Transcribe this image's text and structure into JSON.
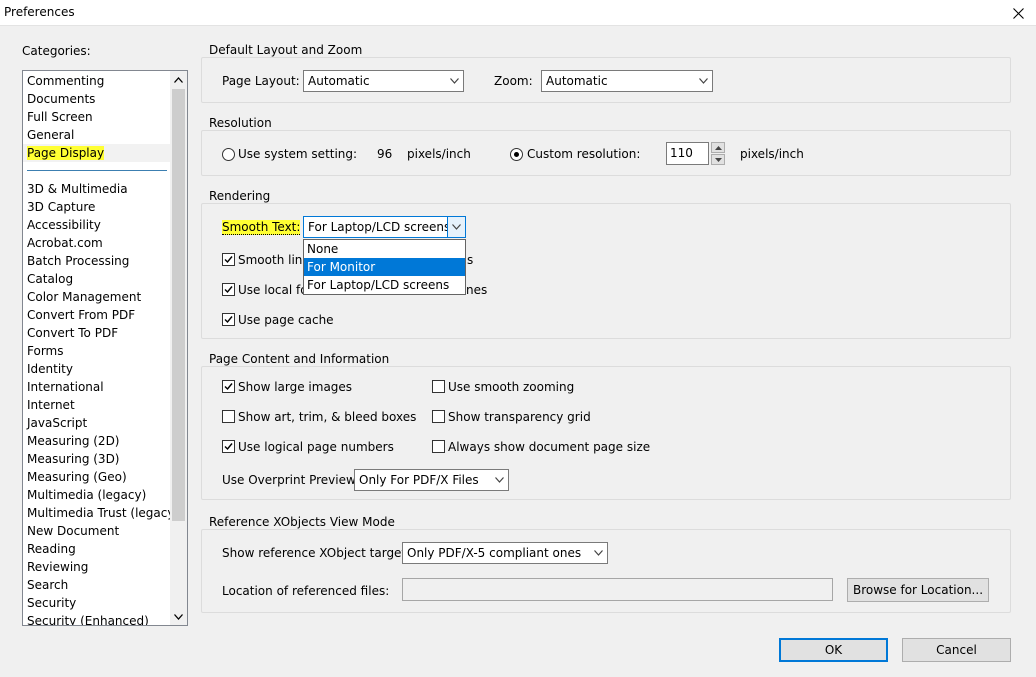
{
  "window": {
    "title": "Preferences"
  },
  "categories": {
    "label": "Categories:",
    "top_items": [
      "Commenting",
      "Documents",
      "Full Screen",
      "General",
      "Page Display"
    ],
    "items": [
      "3D & Multimedia",
      "3D Capture",
      "Accessibility",
      "Acrobat.com",
      "Batch Processing",
      "Catalog",
      "Color Management",
      "Convert From PDF",
      "Convert To PDF",
      "Forms",
      "Identity",
      "International",
      "Internet",
      "JavaScript",
      "Measuring (2D)",
      "Measuring (3D)",
      "Measuring (Geo)",
      "Multimedia (legacy)",
      "Multimedia Trust (legacy)",
      "New Document",
      "Reading",
      "Reviewing",
      "Search",
      "Security",
      "Security (Enhanced)"
    ],
    "selected": "Page Display"
  },
  "layout_zoom": {
    "title": "Default Layout and Zoom",
    "page_layout_label": "Page Layout:",
    "page_layout_value": "Automatic",
    "zoom_label": "Zoom:",
    "zoom_value": "Automatic"
  },
  "resolution": {
    "title": "Resolution",
    "system_label": "Use system setting:",
    "system_value": "96",
    "system_unit": "pixels/inch",
    "custom_label": "Custom resolution:",
    "custom_value": "110",
    "custom_unit": "pixels/inch"
  },
  "rendering": {
    "title": "Rendering",
    "smooth_text_label": "Smooth Text:",
    "smooth_text_value": "For Laptop/LCD screens",
    "smooth_line_label_visible": "Smooth line",
    "smooth_line_tail": "s",
    "local_fonts_label_visible": "Use local fo",
    "local_fonts_tail": "nes",
    "page_cache_label": "Use page cache",
    "dropdown_options": [
      "None",
      "For Monitor",
      "For Laptop/LCD screens"
    ],
    "dropdown_highlighted": "For Monitor"
  },
  "page_content": {
    "title": "Page Content and Information",
    "show_large_images": "Show large images",
    "smooth_zooming": "Use smooth zooming",
    "show_art_boxes": "Show art, trim, & bleed boxes",
    "transparency_grid": "Show transparency grid",
    "logical_page_numbers": "Use logical page numbers",
    "document_page_size": "Always show document page size",
    "overprint_label": "Use Overprint Preview:",
    "overprint_value": "Only For PDF/X Files"
  },
  "xobjects": {
    "title": "Reference XObjects View Mode",
    "targets_label": "Show reference XObject targets:",
    "targets_value": "Only PDF/X-5 compliant ones",
    "location_label": "Location of referenced files:",
    "location_value": "",
    "browse_label": "Browse for Location..."
  },
  "footer": {
    "ok_label": "OK",
    "cancel_label": "Cancel"
  },
  "colors": {
    "highlight": "#ffff33",
    "accent": "#0078d7"
  }
}
